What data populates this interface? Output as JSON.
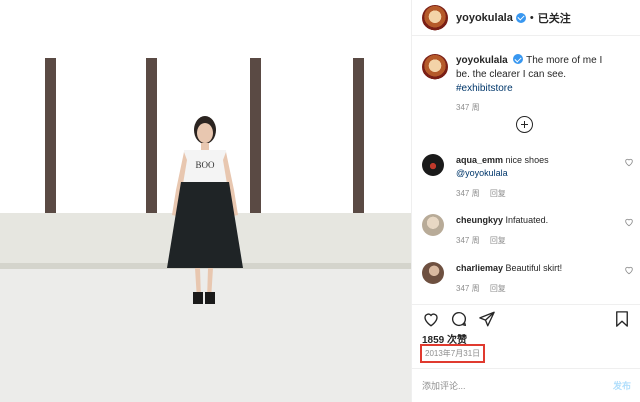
{
  "post": {
    "username": "yoyokulala",
    "header_dot": "•",
    "follow_label": "已关注",
    "caption": {
      "username": "yoyokulala",
      "text": "The more of me I be. the clearer I can see.",
      "hashtag": "#exhibitstore",
      "time": "347 周"
    },
    "photo_shirt_text": "BOO"
  },
  "comments": [
    {
      "username": "aqua_emm",
      "text": "nice shoes",
      "mention": "@yoyokulala",
      "time": "347 周",
      "reply": "回复",
      "avatar_color": "#1a1a1a"
    },
    {
      "username": "cheungkyy",
      "text": "Infatuated.",
      "mention": "",
      "time": "347 周",
      "reply": "回复",
      "avatar_color": "#cfc7b8"
    },
    {
      "username": "charliemay",
      "text": "Beautiful skirt!",
      "mention": "",
      "time": "347 周",
      "reply": "回复",
      "avatar_color": "#8a6a52"
    }
  ],
  "stats": {
    "likes": "1859 次赞",
    "date": "2013年7月31日"
  },
  "composer": {
    "placeholder": "添加评论...",
    "post_label": "发布"
  },
  "icons": {
    "like": "heart-icon",
    "comment": "comment-icon",
    "share": "share-icon",
    "save": "bookmark-icon",
    "add": "plus-circle-icon"
  },
  "colors": {
    "verified": "#3897f0",
    "highlight_box": "#e03a2f",
    "link": "#00376b"
  }
}
